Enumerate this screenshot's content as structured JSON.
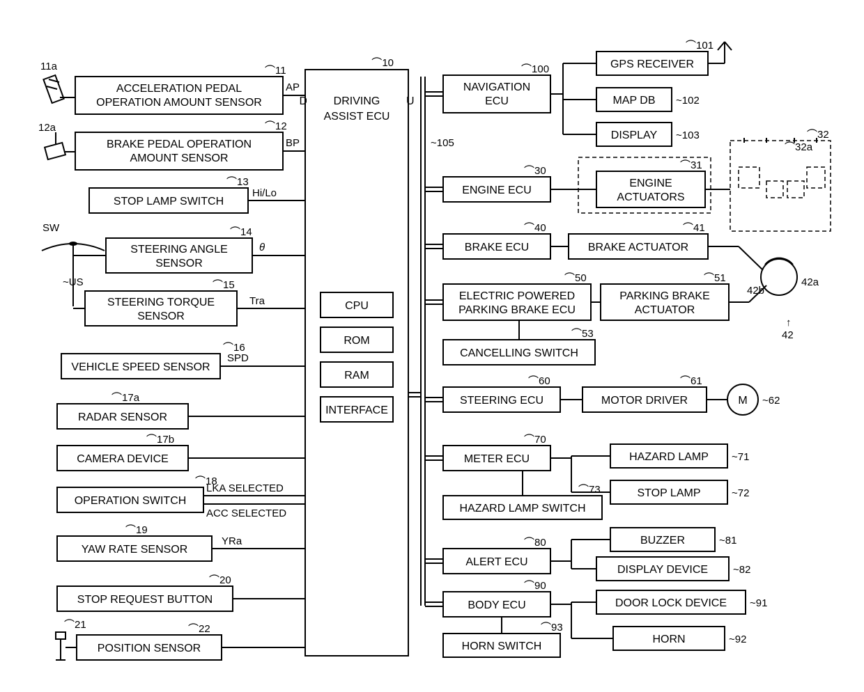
{
  "central": {
    "title": "DRIVING ASSIST ECU",
    "ref": "10",
    "parts": [
      "CPU",
      "ROM",
      "RAM",
      "INTERFACE"
    ]
  },
  "leftSensors": [
    {
      "label": "ACCELERATION PEDAL OPERATION AMOUNT SENSOR",
      "ref": "11",
      "signal": "AP",
      "iconRef": "11a"
    },
    {
      "label": "BRAKE PEDAL OPERATION AMOUNT SENSOR",
      "ref": "12",
      "signal": "BP",
      "iconRef": "12a"
    },
    {
      "label": "STOP LAMP SWITCH",
      "ref": "13",
      "signal": "Hi/Lo"
    },
    {
      "label": "STEERING ANGLE SENSOR",
      "ref": "14",
      "signal": "θ"
    },
    {
      "label": "STEERING TORQUE SENSOR",
      "ref": "15",
      "signal": "Tra"
    },
    {
      "label": "VEHICLE SPEED SENSOR",
      "ref": "16",
      "signal": "SPD"
    },
    {
      "label": "RADAR SENSOR",
      "ref": "17a",
      "signal": ""
    },
    {
      "label": "CAMERA DEVICE",
      "ref": "17b",
      "signal": ""
    },
    {
      "label": "OPERATION SWITCH",
      "ref": "18",
      "signal": "LKA SELECTED / ACC SELECTED"
    },
    {
      "label": "YAW RATE SENSOR",
      "ref": "19",
      "signal": "YRa"
    },
    {
      "label": "STOP REQUEST BUTTON",
      "ref": "20",
      "signal": ""
    },
    {
      "label": "POSITION SENSOR",
      "ref": "22",
      "signal": "",
      "extraRef": "21"
    }
  ],
  "steering": {
    "sw": "SW",
    "us": "US"
  },
  "bus": {
    "ref": "105"
  },
  "rightECUs": [
    {
      "label": "NAVIGATION ECU",
      "ref": "100",
      "children": [
        {
          "label": "GPS RECEIVER",
          "ref": "101"
        },
        {
          "label": "MAP DB",
          "ref": "102"
        },
        {
          "label": "DISPLAY",
          "ref": "103"
        }
      ]
    },
    {
      "label": "ENGINE ECU",
      "ref": "30",
      "children": [
        {
          "label": "ENGINE ACTUATORS",
          "ref": "31"
        }
      ],
      "symbolRefs": {
        "group": "32",
        "part": "32a"
      }
    },
    {
      "label": "BRAKE ECU",
      "ref": "40",
      "children": [
        {
          "label": "BRAKE ACTUATOR",
          "ref": "41"
        }
      ],
      "wheel": {
        "a": "42a",
        "b": "42b",
        "main": "42"
      }
    },
    {
      "label": "ELECTRIC POWERED PARKING BRAKE ECU",
      "ref": "50",
      "children": [
        {
          "label": "PARKING BRAKE ACTUATOR",
          "ref": "51"
        },
        {
          "label": "CANCELLING SWITCH",
          "ref": "53"
        }
      ]
    },
    {
      "label": "STEERING ECU",
      "ref": "60",
      "children": [
        {
          "label": "MOTOR DRIVER",
          "ref": "61"
        }
      ],
      "motor": {
        "label": "M",
        "ref": "62"
      }
    },
    {
      "label": "METER ECU",
      "ref": "70",
      "children": [
        {
          "label": "HAZARD LAMP",
          "ref": "71"
        },
        {
          "label": "STOP LAMP",
          "ref": "72"
        },
        {
          "label": "HAZARD LAMP SWITCH",
          "ref": "73"
        }
      ]
    },
    {
      "label": "ALERT ECU",
      "ref": "80",
      "children": [
        {
          "label": "BUZZER",
          "ref": "81"
        },
        {
          "label": "DISPLAY DEVICE",
          "ref": "82"
        }
      ]
    },
    {
      "label": "BODY ECU",
      "ref": "90",
      "children": [
        {
          "label": "DOOR LOCK DEVICE",
          "ref": "91"
        },
        {
          "label": "HORN",
          "ref": "92"
        },
        {
          "label": "HORN SWITCH",
          "ref": "93"
        }
      ]
    }
  ]
}
